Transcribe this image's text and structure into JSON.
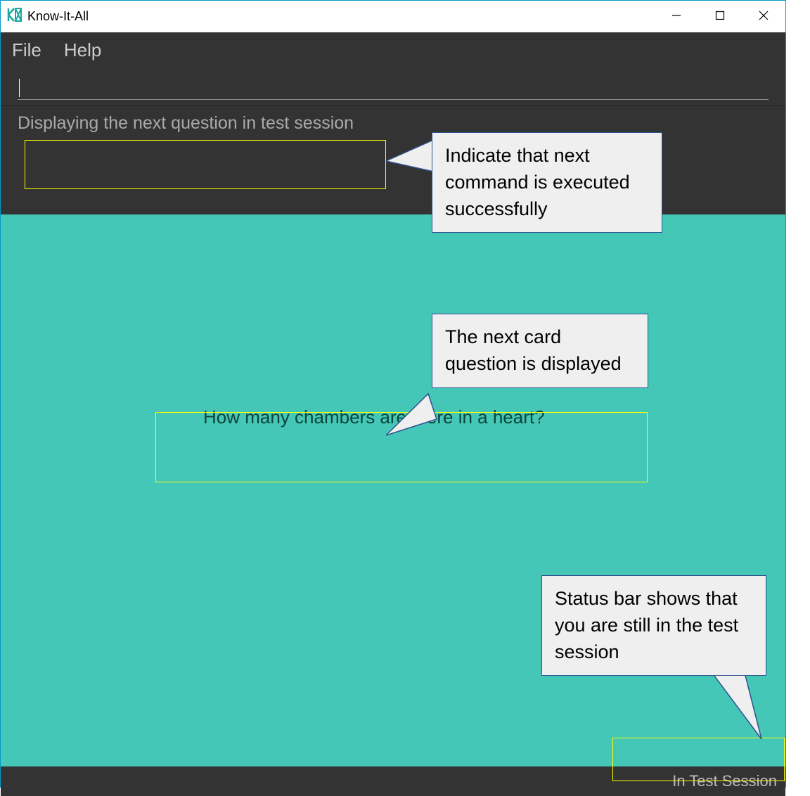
{
  "window": {
    "title": "Know-It-All"
  },
  "menubar": {
    "file": "File",
    "help": "Help"
  },
  "search": {
    "value": ""
  },
  "feedback": {
    "message": "Displaying the next question in test session"
  },
  "question": {
    "text": "How many chambers are there in a heart?"
  },
  "statusbar": {
    "text": "In Test Session"
  },
  "callouts": {
    "c1": "Indicate that next command is executed successfully",
    "c2": "The next card question is displayed",
    "c3": "Status bar shows that you are still in the test session"
  }
}
